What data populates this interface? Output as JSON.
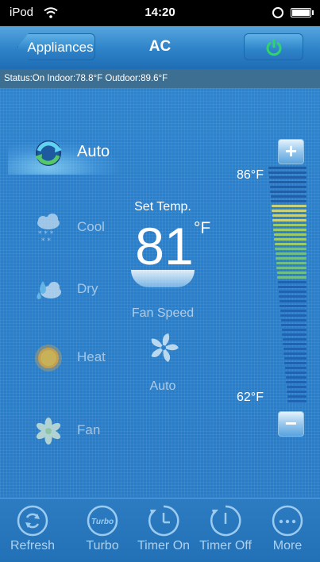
{
  "status_bar": {
    "carrier": "iPod",
    "time": "14:20"
  },
  "nav": {
    "back_label": "Appliances",
    "title": "AC",
    "power_color": "#2fd46a"
  },
  "status_line": {
    "text": "Status:On  Indoor:78.8°F  Outdoor:89.6°F"
  },
  "modes": [
    {
      "label": "Auto",
      "icon": "auto-mode-icon",
      "active": true
    },
    {
      "label": "Cool",
      "icon": "cool-snowflake-cloud-icon",
      "active": false
    },
    {
      "label": "Dry",
      "icon": "dry-droplet-cloud-icon",
      "active": false
    },
    {
      "label": "Heat",
      "icon": "heat-sun-icon",
      "active": false
    },
    {
      "label": "Fan",
      "icon": "fan-mode-icon",
      "active": false
    }
  ],
  "temperature": {
    "set_label": "Set Temp.",
    "value": "81",
    "unit": "°F",
    "max_label": "86°F",
    "min_label": "62°F",
    "setpoint_f": 81,
    "range_f": [
      62,
      86
    ]
  },
  "fan": {
    "label": "Fan Speed",
    "value": "Auto"
  },
  "toolbar": [
    {
      "label": "Refresh",
      "icon": "refresh-icon"
    },
    {
      "label": "Turbo",
      "icon": "turbo-icon",
      "icon_text": "Turbo"
    },
    {
      "label": "Timer On",
      "icon": "timer-on-icon"
    },
    {
      "label": "Timer Off",
      "icon": "timer-off-icon"
    },
    {
      "label": "More",
      "icon": "more-icon"
    }
  ]
}
